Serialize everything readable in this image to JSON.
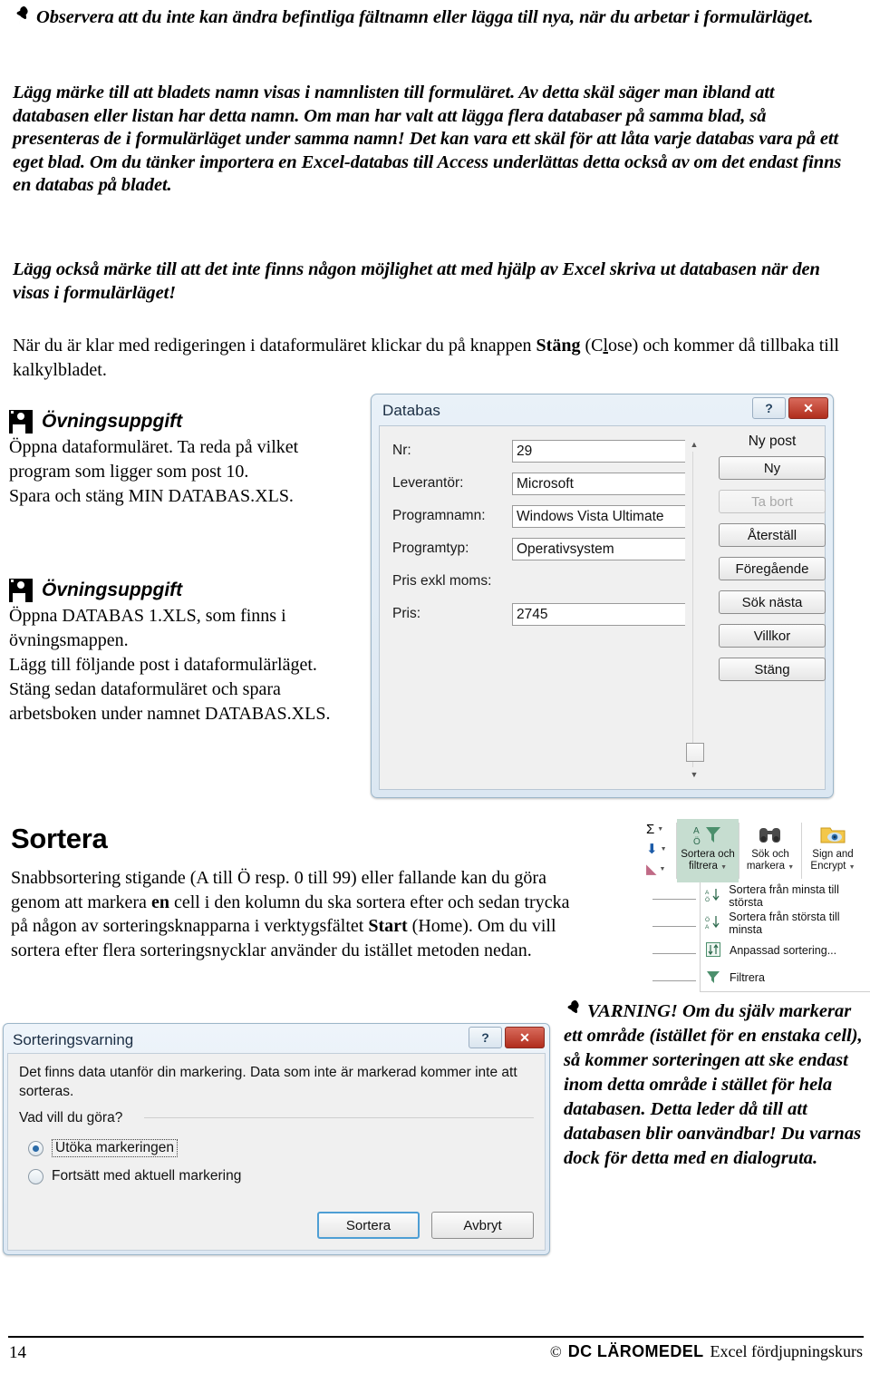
{
  "notes": {
    "note1": "Observera att du inte kan ändra befintliga fältnamn eller lägga till nya, när du arbetar i formulärläget.",
    "note2": "Lägg märke till att bladets namn visas i namnlisten till formuläret. Av detta skäl säger man ibland att databasen eller listan har detta namn. Om man har valt att lägga flera databaser på samma blad, så presenteras de i formulärläget under samma namn! Det kan vara ett skäl för att låta varje databas vara på ett eget blad. Om du tänker importera en Excel-databas till Access underlättas detta också av om det endast finns en databas på bladet.",
    "note3": "Lägg också märke till att det inte finns någon möjlighet att med hjälp av Excel skriva ut databasen när den visas i formulärläget!",
    "para1_a": "När du är klar med redigeringen i dataformuläret klickar du på knappen ",
    "para1_bold": "Stäng",
    "para1_b": " (C",
    "para1_u": "l",
    "para1_c": "ose) och kommer då tillbaka till kalkylbladet."
  },
  "exercises": [
    {
      "icon": "floppy-disk-icon",
      "title": "Övningsuppgift",
      "body": "Öppna dataformuläret. Ta reda på vilket program som ligger som post 10.\nSpara och stäng MIN DATABAS.XLS."
    },
    {
      "icon": "floppy-disk-icon",
      "title": "Övningsuppgift",
      "body": "Öppna DATABAS 1.XLS, som finns i övningsmappen.\nLägg till följande post i dataformulärläget. Stäng sedan dataformuläret och spara arbetsboken under namnet DATABAS.XLS."
    }
  ],
  "databas_dialog": {
    "title": "Databas",
    "help_label": "?",
    "close_label": "✕",
    "new_record_label": "Ny post",
    "fields": [
      {
        "label": "Nr:",
        "value": "29",
        "has_input": true
      },
      {
        "label": "Leverantör:",
        "value": "Microsoft",
        "has_input": true
      },
      {
        "label": "Programnamn:",
        "value": "Windows Vista Ultimate",
        "has_input": true
      },
      {
        "label": "Programtyp:",
        "value": "Operativsystem",
        "has_input": true
      },
      {
        "label": "Pris exkl moms:",
        "value": "",
        "has_input": false
      },
      {
        "label": "Pris:",
        "value": "2745",
        "has_input": true
      }
    ],
    "buttons": [
      {
        "label": "Ny",
        "disabled": false
      },
      {
        "label": "Ta bort",
        "disabled": true
      },
      {
        "label": "Återställ",
        "disabled": false
      },
      {
        "label": "Föregående",
        "disabled": false
      },
      {
        "label": "Sök nästa",
        "disabled": false
      },
      {
        "label": "Villkor",
        "disabled": false
      },
      {
        "label": "Stäng",
        "disabled": false
      }
    ]
  },
  "sortera": {
    "heading": "Sortera",
    "paragraph_a": "Snabbsortering stigande (A till Ö resp. 0 till 99) eller fallande kan du göra genom att markera ",
    "paragraph_bold1": "en",
    "paragraph_b": " cell i den kolumn du ska sortera efter och sedan trycka på någon av sorteringsknapparna i verktygsfältet ",
    "paragraph_bold2": "Start",
    "paragraph_c": " (Home). Om du vill sortera efter flera sorteringsnycklar använder du istället metoden nedan."
  },
  "ribbon": {
    "small_buttons": [
      {
        "icon": "sum-sigma-icon",
        "glyph": "Σ"
      },
      {
        "icon": "fill-down-icon",
        "glyph": "⬇"
      },
      {
        "icon": "clear-eraser-icon",
        "glyph": "◣"
      }
    ],
    "big_buttons": [
      {
        "icon": "sort-filter-icon",
        "line1": "Sortera och",
        "line2": "filtrera",
        "active": true
      },
      {
        "icon": "find-select-icon",
        "line1": "Sök och",
        "line2": "markera",
        "active": false
      },
      {
        "icon": "sign-encrypt-icon",
        "line1": "Sign and",
        "line2": "Encrypt",
        "active": false
      }
    ],
    "menu_items": [
      {
        "icon": "sort-ascending-icon",
        "label": "Sortera från minsta till största"
      },
      {
        "icon": "sort-descending-icon",
        "label": "Sortera från största till minsta"
      },
      {
        "icon": "custom-sort-icon",
        "label": "Anpassad sortering..."
      },
      {
        "icon": "filter-funnel-icon",
        "label": "Filtrera"
      }
    ]
  },
  "varning_dialog": {
    "title": "Sorteringsvarning",
    "help_label": "?",
    "close_label": "✕",
    "message": "Det finns data utanför din markering. Data som inte är markerad kommer inte att sorteras.",
    "question": "Vad vill du göra?",
    "options": [
      {
        "label": "Utöka markeringen",
        "selected": true
      },
      {
        "label": "Fortsätt med aktuell markering",
        "selected": false
      }
    ],
    "buttons": [
      {
        "label": "Sortera",
        "primary": true
      },
      {
        "label": "Avbryt",
        "primary": false
      }
    ]
  },
  "warning_note": "VARNING! Om du själv markerar ett område (istället för en enstaka cell), så kommer sorteringen att ske endast inom detta område i stället för hela databasen. Detta leder då till att databasen blir oanvändbar! Du varnas dock för detta med en dialogruta.",
  "footer": {
    "page_number": "14",
    "copyright_symbol": "©",
    "publisher": "DC LÄROMEDEL",
    "course": "Excel fördjupningskurs"
  },
  "colors": {
    "ribbon_active": "#c6ddd0",
    "dialog_blue": "#dbe7f2",
    "close_red": "#b02d1c",
    "radio_blue": "#2b6ba8"
  }
}
